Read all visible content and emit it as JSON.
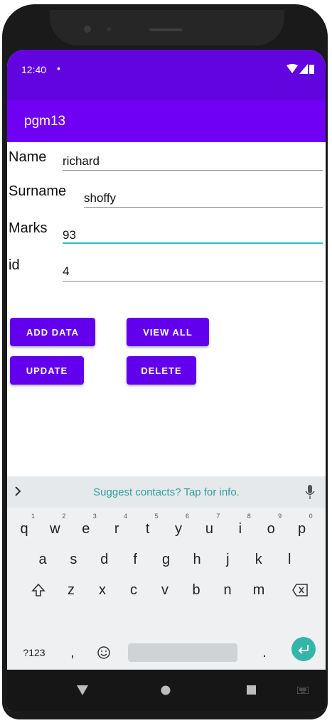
{
  "status": {
    "time": "12:40",
    "dot": "•"
  },
  "app": {
    "title": "pgm13"
  },
  "form": {
    "name": {
      "label": "Name",
      "value": "richard"
    },
    "surname": {
      "label": "Surname",
      "value": "shoffy"
    },
    "marks": {
      "label": "Marks",
      "value": "93"
    },
    "id": {
      "label": "id",
      "value": "4"
    }
  },
  "buttons": {
    "add": "ADD DATA",
    "view": "VIEW ALL",
    "update": "UPDATE",
    "delete": "DELETE"
  },
  "keyboard": {
    "suggest": "Suggest contacts? Tap for info.",
    "row1": [
      {
        "k": "q",
        "n": "1"
      },
      {
        "k": "w",
        "n": "2"
      },
      {
        "k": "e",
        "n": "3"
      },
      {
        "k": "r",
        "n": "4"
      },
      {
        "k": "t",
        "n": "5"
      },
      {
        "k": "y",
        "n": "6"
      },
      {
        "k": "u",
        "n": "7"
      },
      {
        "k": "i",
        "n": "8"
      },
      {
        "k": "o",
        "n": "9"
      },
      {
        "k": "p",
        "n": "0"
      }
    ],
    "row2": [
      "a",
      "s",
      "d",
      "f",
      "g",
      "h",
      "j",
      "k",
      "l"
    ],
    "row3": [
      "z",
      "x",
      "c",
      "v",
      "b",
      "n",
      "m"
    ],
    "sym": "?123",
    "comma": ",",
    "period": "."
  },
  "colors": {
    "statusbar": "#6104e0",
    "appbar": "#6f00f4",
    "button": "#6200ee",
    "accent": "#21c6c0",
    "enter": "#35b5a8"
  }
}
